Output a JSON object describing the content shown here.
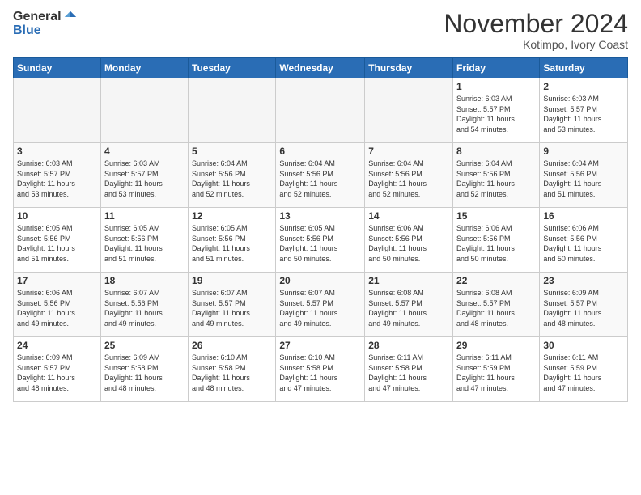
{
  "logo": {
    "general": "General",
    "blue": "Blue"
  },
  "header": {
    "month": "November 2024",
    "location": "Kotimpo, Ivory Coast"
  },
  "weekdays": [
    "Sunday",
    "Monday",
    "Tuesday",
    "Wednesday",
    "Thursday",
    "Friday",
    "Saturday"
  ],
  "weeks": [
    [
      {
        "day": "",
        "info": ""
      },
      {
        "day": "",
        "info": ""
      },
      {
        "day": "",
        "info": ""
      },
      {
        "day": "",
        "info": ""
      },
      {
        "day": "",
        "info": ""
      },
      {
        "day": "1",
        "info": "Sunrise: 6:03 AM\nSunset: 5:57 PM\nDaylight: 11 hours\nand 54 minutes."
      },
      {
        "day": "2",
        "info": "Sunrise: 6:03 AM\nSunset: 5:57 PM\nDaylight: 11 hours\nand 53 minutes."
      }
    ],
    [
      {
        "day": "3",
        "info": "Sunrise: 6:03 AM\nSunset: 5:57 PM\nDaylight: 11 hours\nand 53 minutes."
      },
      {
        "day": "4",
        "info": "Sunrise: 6:03 AM\nSunset: 5:57 PM\nDaylight: 11 hours\nand 53 minutes."
      },
      {
        "day": "5",
        "info": "Sunrise: 6:04 AM\nSunset: 5:56 PM\nDaylight: 11 hours\nand 52 minutes."
      },
      {
        "day": "6",
        "info": "Sunrise: 6:04 AM\nSunset: 5:56 PM\nDaylight: 11 hours\nand 52 minutes."
      },
      {
        "day": "7",
        "info": "Sunrise: 6:04 AM\nSunset: 5:56 PM\nDaylight: 11 hours\nand 52 minutes."
      },
      {
        "day": "8",
        "info": "Sunrise: 6:04 AM\nSunset: 5:56 PM\nDaylight: 11 hours\nand 52 minutes."
      },
      {
        "day": "9",
        "info": "Sunrise: 6:04 AM\nSunset: 5:56 PM\nDaylight: 11 hours\nand 51 minutes."
      }
    ],
    [
      {
        "day": "10",
        "info": "Sunrise: 6:05 AM\nSunset: 5:56 PM\nDaylight: 11 hours\nand 51 minutes."
      },
      {
        "day": "11",
        "info": "Sunrise: 6:05 AM\nSunset: 5:56 PM\nDaylight: 11 hours\nand 51 minutes."
      },
      {
        "day": "12",
        "info": "Sunrise: 6:05 AM\nSunset: 5:56 PM\nDaylight: 11 hours\nand 51 minutes."
      },
      {
        "day": "13",
        "info": "Sunrise: 6:05 AM\nSunset: 5:56 PM\nDaylight: 11 hours\nand 50 minutes."
      },
      {
        "day": "14",
        "info": "Sunrise: 6:06 AM\nSunset: 5:56 PM\nDaylight: 11 hours\nand 50 minutes."
      },
      {
        "day": "15",
        "info": "Sunrise: 6:06 AM\nSunset: 5:56 PM\nDaylight: 11 hours\nand 50 minutes."
      },
      {
        "day": "16",
        "info": "Sunrise: 6:06 AM\nSunset: 5:56 PM\nDaylight: 11 hours\nand 50 minutes."
      }
    ],
    [
      {
        "day": "17",
        "info": "Sunrise: 6:06 AM\nSunset: 5:56 PM\nDaylight: 11 hours\nand 49 minutes."
      },
      {
        "day": "18",
        "info": "Sunrise: 6:07 AM\nSunset: 5:56 PM\nDaylight: 11 hours\nand 49 minutes."
      },
      {
        "day": "19",
        "info": "Sunrise: 6:07 AM\nSunset: 5:57 PM\nDaylight: 11 hours\nand 49 minutes."
      },
      {
        "day": "20",
        "info": "Sunrise: 6:07 AM\nSunset: 5:57 PM\nDaylight: 11 hours\nand 49 minutes."
      },
      {
        "day": "21",
        "info": "Sunrise: 6:08 AM\nSunset: 5:57 PM\nDaylight: 11 hours\nand 49 minutes."
      },
      {
        "day": "22",
        "info": "Sunrise: 6:08 AM\nSunset: 5:57 PM\nDaylight: 11 hours\nand 48 minutes."
      },
      {
        "day": "23",
        "info": "Sunrise: 6:09 AM\nSunset: 5:57 PM\nDaylight: 11 hours\nand 48 minutes."
      }
    ],
    [
      {
        "day": "24",
        "info": "Sunrise: 6:09 AM\nSunset: 5:57 PM\nDaylight: 11 hours\nand 48 minutes."
      },
      {
        "day": "25",
        "info": "Sunrise: 6:09 AM\nSunset: 5:58 PM\nDaylight: 11 hours\nand 48 minutes."
      },
      {
        "day": "26",
        "info": "Sunrise: 6:10 AM\nSunset: 5:58 PM\nDaylight: 11 hours\nand 48 minutes."
      },
      {
        "day": "27",
        "info": "Sunrise: 6:10 AM\nSunset: 5:58 PM\nDaylight: 11 hours\nand 47 minutes."
      },
      {
        "day": "28",
        "info": "Sunrise: 6:11 AM\nSunset: 5:58 PM\nDaylight: 11 hours\nand 47 minutes."
      },
      {
        "day": "29",
        "info": "Sunrise: 6:11 AM\nSunset: 5:59 PM\nDaylight: 11 hours\nand 47 minutes."
      },
      {
        "day": "30",
        "info": "Sunrise: 6:11 AM\nSunset: 5:59 PM\nDaylight: 11 hours\nand 47 minutes."
      }
    ]
  ]
}
